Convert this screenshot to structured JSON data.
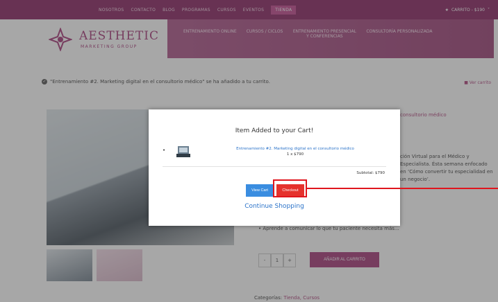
{
  "topnav": {
    "items": [
      "NOSOTROS",
      "CONTACTO",
      "BLOG",
      "PROGRAMAS",
      "CURSOS",
      "EVENTOS",
      "TIENDA"
    ],
    "cart_label": "CARRITO - $190"
  },
  "brand": {
    "name": "AESTHETIC",
    "subtitle": "MARKETING GROUP"
  },
  "mainnav": {
    "items": [
      "ENTRENAMIENTO ONLINE",
      "CURSOS / CICLOS",
      "ENTRENAMIENTO PRESENCIAL Y CONFERENCIAS",
      "CONSULTORÍA PERSONALIZADA"
    ]
  },
  "notice": {
    "text": "\"Entrenamiento #2. Marketing digital en el consultorio médico\" se ha añadido a tu carrito.",
    "view_cart": "Ver carrito"
  },
  "product": {
    "title_fragment": "consultorio médico",
    "desc_fragment": "ción Virtual para el Médico y Especialista. Ésta semana enfocado en ‘Cómo convertir tu especialidad en un negocio’.",
    "bullet": "Aprende a comunicar lo que tu paciente necesita más…",
    "qty_minus": "-",
    "qty_value": "1",
    "qty_plus": "+",
    "add_to_cart": "AÑADIR AL CARRITO",
    "categories_label": "Categorías:",
    "categories_value": "Tienda, Cursos"
  },
  "modal": {
    "title": "Item Added to your Cart!",
    "product_name": "Entrenamiento #2. Marketing digital en el consultorio médico",
    "product_qty": "1 x $790",
    "subtotal": "Subtotal: $790",
    "view_cart_button": "View Cart",
    "checkout_button": "Checkout",
    "continue_link": "Continue Shopping"
  },
  "colors": {
    "brand": "#a83e7c",
    "checkout": "#e5322d",
    "view_cart": "#3a8de0",
    "highlight": "#e0151d"
  }
}
